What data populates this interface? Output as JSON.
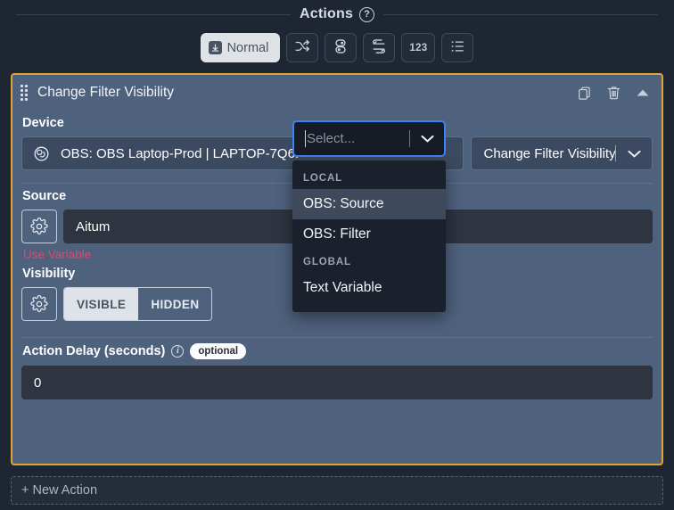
{
  "header": {
    "title": "Actions",
    "help_icon": "question-circle-icon"
  },
  "toolbar": {
    "buttons": [
      {
        "label": "Normal",
        "icon": "download-arrow-icon",
        "active": true
      },
      {
        "label": "",
        "icon": "shuffle-icon",
        "active": false
      },
      {
        "label": "",
        "icon": "toggle-switch-icon",
        "active": false
      },
      {
        "label": "",
        "icon": "swap-arrows-icon",
        "active": false
      },
      {
        "label": "123",
        "icon": "number-icon",
        "active": false
      },
      {
        "label": "",
        "icon": "list-icon",
        "active": false
      }
    ]
  },
  "action_card": {
    "title": "Change Filter Visibility",
    "drag_handle": "drag-dots-icon",
    "header_icons": [
      {
        "name": "duplicate-icon"
      },
      {
        "name": "trash-icon"
      },
      {
        "name": "collapse-caret-up-icon"
      }
    ],
    "device": {
      "label": "Device",
      "value": "OBS: OBS Laptop-Prod | LAPTOP-7Q6.",
      "icon": "obs-logo-icon",
      "action_value": "Change Filter Visibility",
      "action_value_visible": "isibility"
    },
    "source": {
      "label": "Source",
      "gear_icon": "gear-icon",
      "value": "Aitum",
      "error_note": "Use Variable",
      "error_note_visible": "iable"
    },
    "visibility": {
      "label": "Visibility",
      "gear_icon": "gear-icon",
      "options": [
        {
          "label": "VISIBLE",
          "selected": true
        },
        {
          "label": "HIDDEN",
          "selected": false
        }
      ]
    },
    "delay": {
      "label": "Action Delay (seconds)",
      "info_icon": "info-icon",
      "badge": "optional",
      "value": "0"
    }
  },
  "dropdown": {
    "placeholder": "Select...",
    "chevron_icon": "chevron-down-icon",
    "groups": [
      {
        "label": "LOCAL",
        "items": [
          {
            "label": "OBS: Source",
            "highlighted": true
          },
          {
            "label": "OBS: Filter",
            "highlighted": false
          }
        ]
      },
      {
        "label": "GLOBAL",
        "items": [
          {
            "label": "Text Variable",
            "highlighted": false
          }
        ]
      }
    ]
  },
  "new_action": {
    "label": "+ New Action"
  },
  "colors": {
    "page_bg": "#1f2633",
    "card_bg": "#4e627d",
    "card_border": "#e0a434",
    "accent_focus": "#3b82f6",
    "error": "#e1476f",
    "field_dark": "#2e3440"
  }
}
